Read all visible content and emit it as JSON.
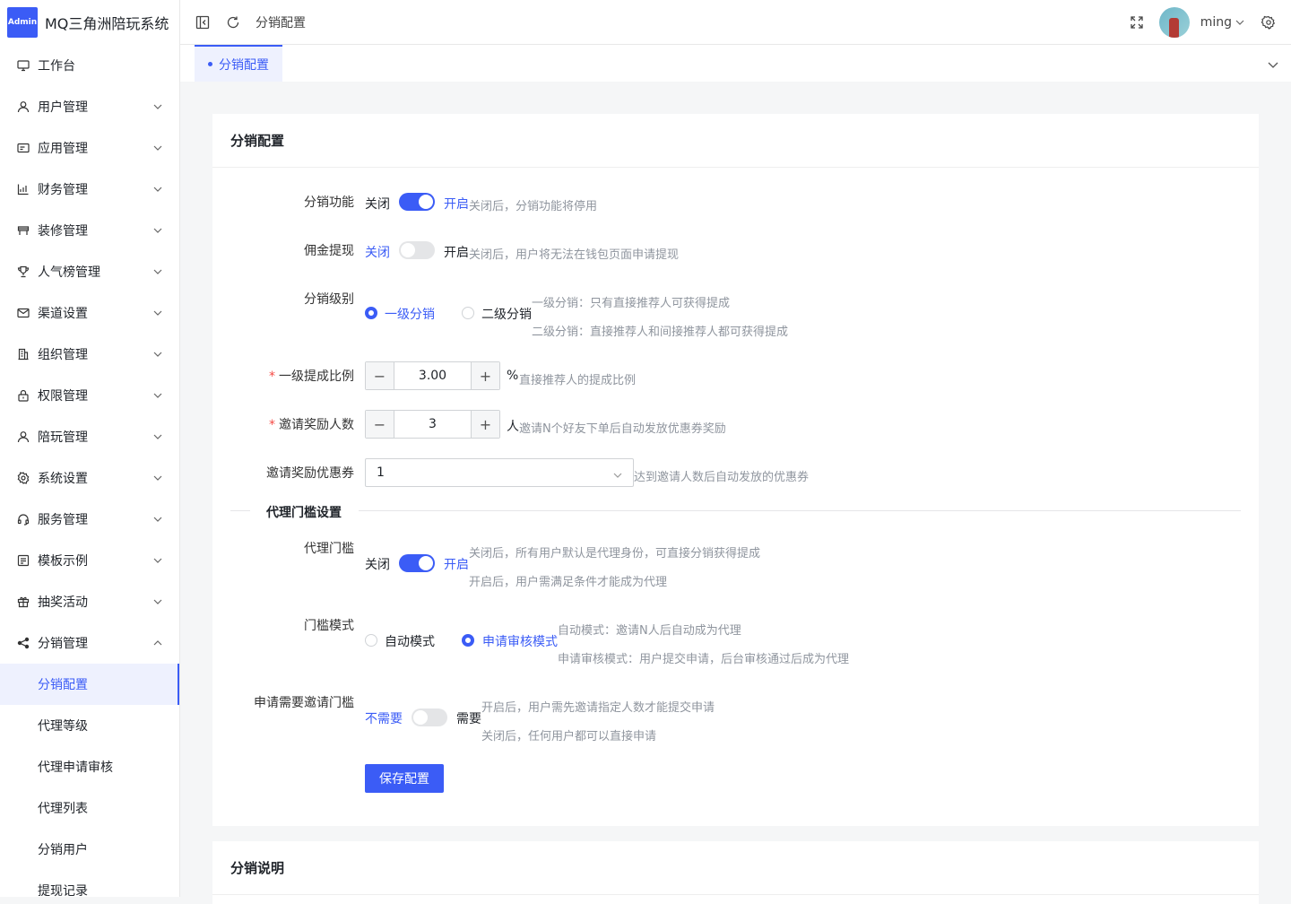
{
  "app": {
    "badge": "Admin",
    "title": "MQ三角洲陪玩系统"
  },
  "sidebar": {
    "items": [
      {
        "label": "工作台",
        "icon": "monitor-icon"
      },
      {
        "label": "用户管理",
        "icon": "user-icon"
      },
      {
        "label": "应用管理",
        "icon": "app-icon"
      },
      {
        "label": "财务管理",
        "icon": "chart-icon"
      },
      {
        "label": "装修管理",
        "icon": "decoration-icon"
      },
      {
        "label": "人气榜管理",
        "icon": "trophy-icon"
      },
      {
        "label": "渠道设置",
        "icon": "mail-icon"
      },
      {
        "label": "组织管理",
        "icon": "building-icon"
      },
      {
        "label": "权限管理",
        "icon": "lock-icon"
      },
      {
        "label": "陪玩管理",
        "icon": "user-icon"
      },
      {
        "label": "系统设置",
        "icon": "gear-icon"
      },
      {
        "label": "服务管理",
        "icon": "headset-icon"
      },
      {
        "label": "模板示例",
        "icon": "template-icon"
      },
      {
        "label": "抽奖活动",
        "icon": "gift-icon"
      },
      {
        "label": "分销管理",
        "icon": "share-icon"
      }
    ],
    "sub_items": [
      {
        "label": "分销配置"
      },
      {
        "label": "代理等级"
      },
      {
        "label": "代理申请审核"
      },
      {
        "label": "代理列表"
      },
      {
        "label": "分销用户"
      },
      {
        "label": "提现记录"
      }
    ]
  },
  "topbar": {
    "breadcrumb": "分销配置",
    "username": "ming"
  },
  "tabs": [
    {
      "label": "分销配置"
    }
  ],
  "config": {
    "card_title": "分销配置",
    "distribution": {
      "label": "分销功能",
      "off": "关闭",
      "on": "开启",
      "enabled": true,
      "hint": "关闭后，分销功能将停用"
    },
    "withdraw": {
      "label": "佣金提现",
      "off": "关闭",
      "on": "开启",
      "enabled": false,
      "hint": "关闭后，用户将无法在钱包页面申请提现"
    },
    "level": {
      "label": "分销级别",
      "options": [
        "一级分销",
        "二级分销"
      ],
      "selected": "一级分销",
      "hint1": "一级分销：只有直接推荐人可获得提成",
      "hint2": "二级分销：直接推荐人和间接推荐人都可获得提成"
    },
    "ratio": {
      "label": "一级提成比例",
      "value": "3.00",
      "unit": "%",
      "hint": "直接推荐人的提成比例"
    },
    "invite_count": {
      "label": "邀请奖励人数",
      "value": "3",
      "unit": "人",
      "hint": "邀请N个好友下单后自动发放优惠券奖励"
    },
    "coupon": {
      "label": "邀请奖励优惠券",
      "value": "1",
      "hint": "达到邀请人数后自动发放的优惠券"
    },
    "agent_section": "代理门槛设置",
    "agent_threshold": {
      "label": "代理门槛",
      "off": "关闭",
      "on": "开启",
      "enabled": true,
      "hint1": "关闭后，所有用户默认是代理身份，可直接分销获得提成",
      "hint2": "开启后，用户需满足条件才能成为代理"
    },
    "threshold_mode": {
      "label": "门槛模式",
      "options": [
        "自动模式",
        "申请审核模式"
      ],
      "selected": "申请审核模式",
      "hint1": "自动模式：邀请N人后自动成为代理",
      "hint2": "申请审核模式：用户提交申请，后台审核通过后成为代理"
    },
    "invite_threshold": {
      "label": "申请需要邀请门槛",
      "off": "不需要",
      "on": "需要",
      "enabled": false,
      "hint1": "开启后，用户需先邀请指定人数才能提交申请",
      "hint2": "关闭后，任何用户都可以直接申请"
    },
    "save_label": "保存配置"
  },
  "info": {
    "card_title": "分销说明"
  },
  "colors": {
    "accent": "#3b5cf6",
    "danger": "#f54a45"
  }
}
